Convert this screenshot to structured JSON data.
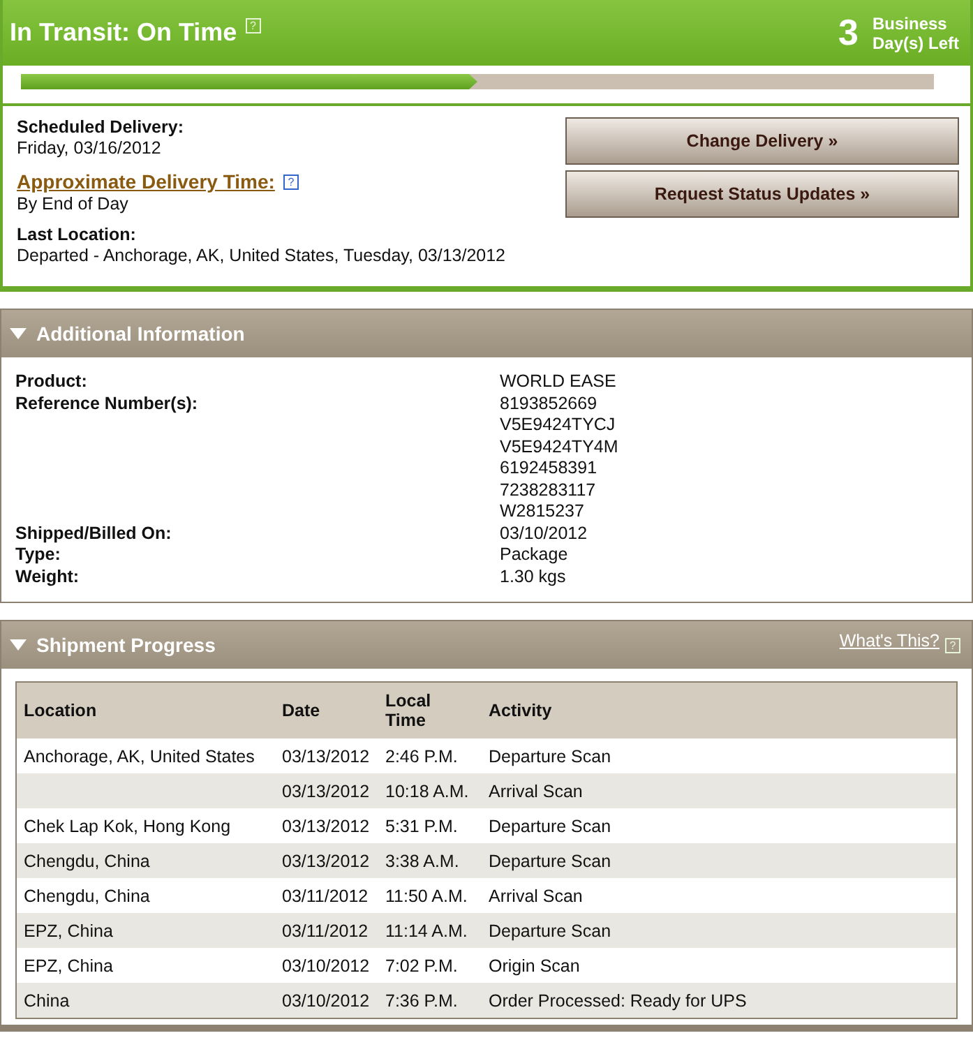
{
  "status": {
    "title": "In Transit: On Time",
    "help": "?",
    "days": "3",
    "days_label": "Business Day(s) Left"
  },
  "progress": {
    "level": 0.5
  },
  "summary": {
    "scheduled_label": "Scheduled Delivery:",
    "scheduled_value": "Friday, 03/16/2012",
    "approx_label": "Approximate Delivery Time:",
    "approx_help": "?",
    "approx_value": "By End of Day",
    "last_label": "Last Location:",
    "last_value": "Departed - Anchorage, AK, United States, Tuesday, 03/13/2012"
  },
  "buttons": [
    "Change Delivery »",
    "Request Status Updates »"
  ],
  "additional": {
    "title": "Additional Information",
    "expanded": true,
    "fields": [
      {
        "label": "Product:",
        "values": [
          "WORLD EASE"
        ]
      },
      {
        "label": "Reference Number(s):",
        "values": [
          "8193852669",
          "V5E9424TYCJ",
          "V5E9424TY4M",
          "6192458391",
          "7238283117",
          "W2815237"
        ]
      },
      {
        "label": "Shipped/Billed On:",
        "values": [
          "03/10/2012"
        ]
      },
      {
        "label": "Type:",
        "values": [
          "Package"
        ]
      },
      {
        "label": "Weight:",
        "values": [
          "1.30 kgs"
        ]
      }
    ]
  },
  "progress_section": {
    "title": "Shipment Progress",
    "expanded": true,
    "link": "What's This?",
    "help": "?",
    "columns": [
      "Location",
      "Date",
      "Local Time",
      "Activity"
    ],
    "rows": [
      [
        "Anchorage, AK, United States",
        "03/13/2012",
        "2:46 P.M.",
        "Departure Scan"
      ],
      [
        "",
        "03/13/2012",
        "10:18 A.M.",
        "Arrival Scan"
      ],
      [
        "Chek Lap Kok, Hong Kong",
        "03/13/2012",
        "5:31 P.M.",
        "Departure Scan"
      ],
      [
        "Chengdu, China",
        "03/13/2012",
        "3:38 A.M.",
        "Departure Scan"
      ],
      [
        "Chengdu, China",
        "03/11/2012",
        "11:50 A.M.",
        "Arrival Scan"
      ],
      [
        "EPZ, China",
        "03/11/2012",
        "11:14 A.M.",
        "Departure Scan"
      ],
      [
        "EPZ, China",
        "03/10/2012",
        "7:02 P.M.",
        "Origin Scan"
      ],
      [
        "China",
        "03/10/2012",
        "7:36 P.M.",
        "Order Processed: Ready for UPS"
      ]
    ]
  }
}
